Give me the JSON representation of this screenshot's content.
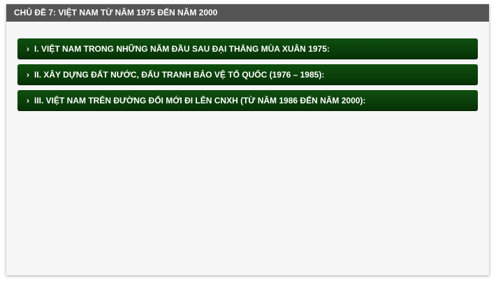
{
  "header": {
    "title": "CHỦ ĐỀ 7: VIỆT NAM TỪ NĂM 1975 ĐẾN NĂM 2000"
  },
  "accordion": {
    "items": [
      {
        "label": "I. VIỆT NAM TRONG NHỮNG NĂM ĐẦU SAU ĐẠI THẮNG MÙA XUÂN 1975:",
        "icon": "chevron-right-icon"
      },
      {
        "label": "II. XÂY DỰNG ĐẤT NƯỚC, ĐẤU TRANH BẢO VỆ TỔ QUỐC (1976 – 1985):",
        "icon": "chevron-right-icon"
      },
      {
        "label": "III. VIỆT NAM TRÊN ĐƯỜNG ĐỔI MỚI ĐI LÊN CNXH (TỪ NĂM 1986 ĐẾN NĂM 2000):",
        "icon": "chevron-right-icon"
      }
    ]
  },
  "colors": {
    "header_bg": "#555555",
    "item_bg": "#0a3f0a",
    "card_bg": "#f6f6f6"
  }
}
